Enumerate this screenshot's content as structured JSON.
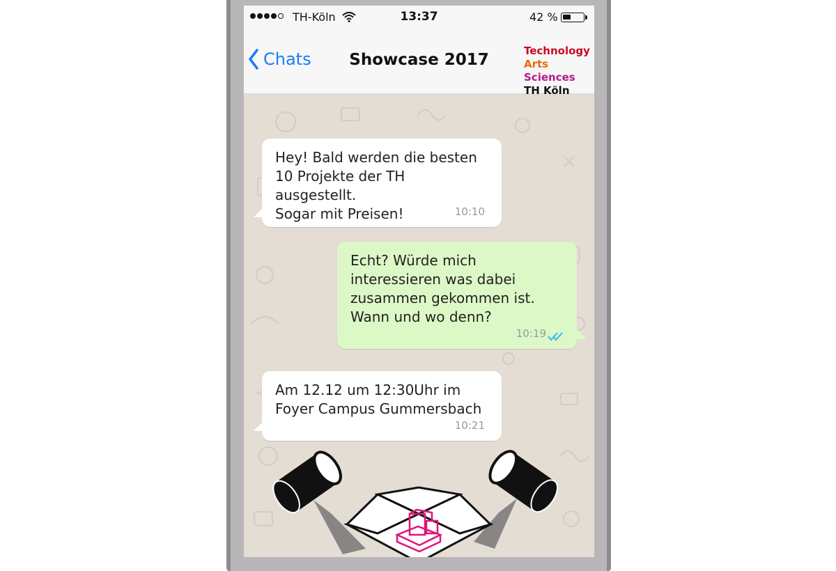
{
  "statusbar": {
    "carrier": "TH-Köln",
    "time": "13:37",
    "battery_percent": "42 %",
    "battery_level": 0.42,
    "signal_bars": 4,
    "signal_bars_max": 5,
    "icons": [
      "signal-dots-icon",
      "wifi-icon",
      "battery-icon"
    ]
  },
  "navbar": {
    "back_label": "Chats",
    "back_icon": "chevron-left-icon",
    "title": "Showcase 2017",
    "logo": {
      "line1": "Technology",
      "line2a": "Arts",
      "line2b": "Sciences",
      "line3": "TH Köln"
    }
  },
  "messages": [
    {
      "direction": "incoming",
      "text": "Hey! Bald werden die besten\n10 Projekte der TH ausgestellt.\nSogar mit Preisen!",
      "time": "10:10"
    },
    {
      "direction": "outgoing",
      "text": "Echt? Würde mich\ninteressieren was dabei\nzusammen gekommen ist.\nWann und wo denn?",
      "time": "10:19",
      "read_icon": "double-check-icon"
    },
    {
      "direction": "incoming",
      "text": "Am 12.12 um 12:30Uhr im\nFoyer Campus Gummersbach",
      "time": "10:21"
    }
  ],
  "colors": {
    "accent": "#1a7cf5",
    "chat_background": "#e3ddd4",
    "incoming_bubble": "#ffffff",
    "outgoing_bubble": "#dcf8c6",
    "read_ticks": "#34b7f1",
    "illustration_accent": "#e0147a",
    "logo_red": "#cc0a22",
    "logo_orange": "#ea6a0a",
    "logo_purple": "#b3188a"
  },
  "illustration": {
    "icon": "spotlights-exhibition-icon"
  }
}
